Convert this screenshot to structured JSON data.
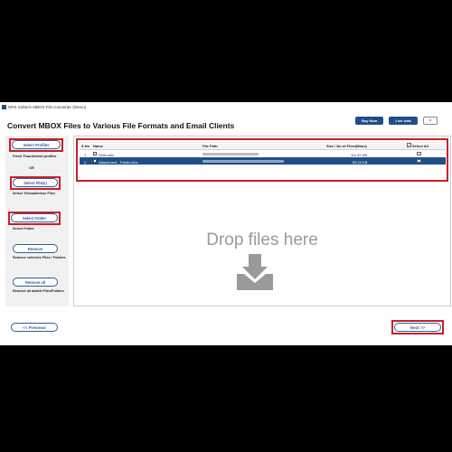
{
  "window": {
    "title": "DRS Softech MBOX File Converter (Demo)"
  },
  "header": {
    "heading": "Convert MBOX Files to Various File Formats and Email Clients",
    "buy_now": "Buy Now",
    "live_chat": "Live chat",
    "close": "×"
  },
  "sidebar": {
    "select_profiles": "Select Profiles",
    "fetch_text": "Fetch Thunderbird profiles",
    "or_text": "OR",
    "select_files": "Select File(s)",
    "select_files_text": "Select Tekmail/mbox Files",
    "select_folder": "Select Folder",
    "select_folder_text": "Select Folder",
    "remove": "Remove",
    "remove_text": "Remove selective Files / Folders",
    "remove_all": "Remove all",
    "remove_all_text": "Remove all added Files/Folders"
  },
  "table": {
    "headers": {
      "sno": "S.No",
      "name": "Name",
      "path": "File Path",
      "size": "Size / No of Files(Mbox)",
      "select_all": "Select All"
    },
    "rows": [
      {
        "sno": "1",
        "name": "Sent.mbx",
        "size": "111.57 KB",
        "checked": "✓"
      },
      {
        "sno": "2",
        "name": "Attachment - Folder.mbx",
        "size": "59.22 KB",
        "checked": "✓"
      }
    ]
  },
  "drop": {
    "text": "Drop files here"
  },
  "footer": {
    "previous": "<< Previous",
    "next": "Next >>"
  },
  "colors": {
    "accent": "#1f4e8a",
    "highlight": "#c9202a"
  },
  "icons": {
    "drop": "download-tray-icon",
    "file": "file-icon"
  }
}
